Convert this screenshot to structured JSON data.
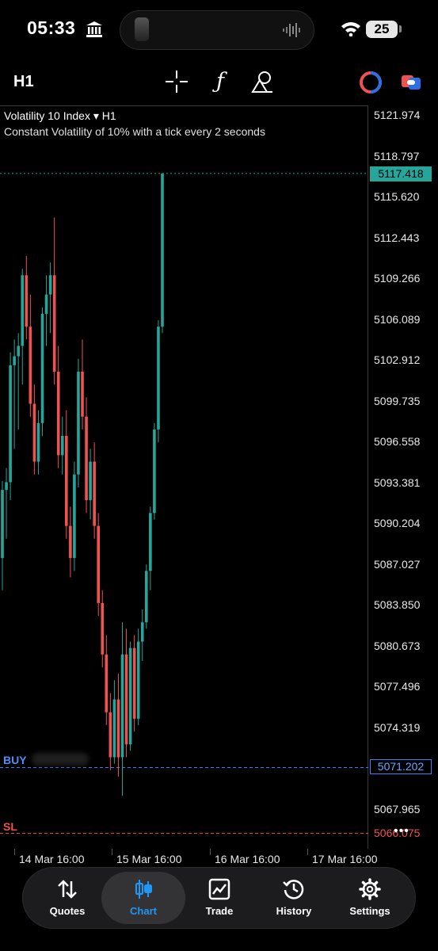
{
  "status_bar": {
    "time": "05:33",
    "battery": "25"
  },
  "toolbar": {
    "timeframe": "H1"
  },
  "chart": {
    "symbol": "Volatility 10 Index",
    "symbol_suffix": "▾ H1",
    "description": "Constant Volatility of 10% with a tick every 2 seconds",
    "current_price": "5117.418",
    "buy_price": "5071.202",
    "sl_price": "5066.075",
    "buy_label": "BUY",
    "sl_label": "SL",
    "colors": {
      "up": "#26a69a",
      "down": "#ef5350",
      "buy": "#3b82f6",
      "sl": "#ef5350"
    }
  },
  "chart_data": {
    "type": "candlestick",
    "ylim": [
      5064.5,
      5123.5
    ],
    "yticks": [
      "5121.974",
      "5118.797",
      "5115.620",
      "5112.443",
      "5109.266",
      "5106.089",
      "5102.912",
      "5099.735",
      "5096.558",
      "5093.381",
      "5090.204",
      "5087.027",
      "5083.850",
      "5080.673",
      "5077.496",
      "5074.319",
      "5067.965"
    ],
    "xticks": [
      "14 Mar 16:00",
      "15 Mar 16:00",
      "16 Mar 16:00",
      "17 Mar 16:00"
    ],
    "candles": [
      [
        5087.5,
        5093.5,
        5085.0,
        5092.8
      ],
      [
        5092.8,
        5094.5,
        5089.0,
        5093.4
      ],
      [
        5093.4,
        5103.5,
        5092.0,
        5102.5
      ],
      [
        5102.5,
        5104.5,
        5096.0,
        5103.2
      ],
      [
        5103.2,
        5105.0,
        5097.5,
        5104.0
      ],
      [
        5104.0,
        5110.0,
        5101.0,
        5109.5
      ],
      [
        5109.5,
        5111.0,
        5104.5,
        5105.5
      ],
      [
        5105.5,
        5108.0,
        5098.5,
        5099.5
      ],
      [
        5099.5,
        5101.0,
        5094.0,
        5095.0
      ],
      [
        5095.0,
        5099.0,
        5094.0,
        5098.0
      ],
      [
        5098.0,
        5107.0,
        5097.0,
        5106.5
      ],
      [
        5106.5,
        5109.5,
        5104.0,
        5108.0
      ],
      [
        5108.0,
        5110.5,
        5105.0,
        5109.5
      ],
      [
        5109.5,
        5114.0,
        5101.0,
        5102.0
      ],
      [
        5102.0,
        5104.0,
        5094.5,
        5095.5
      ],
      [
        5095.5,
        5098.5,
        5094.0,
        5097.0
      ],
      [
        5097.0,
        5099.0,
        5089.0,
        5090.0
      ],
      [
        5090.0,
        5091.5,
        5086.0,
        5087.5
      ],
      [
        5087.5,
        5095.0,
        5086.5,
        5094.0
      ],
      [
        5094.0,
        5103.0,
        5093.0,
        5102.0
      ],
      [
        5102.0,
        5104.5,
        5097.5,
        5098.5
      ],
      [
        5098.5,
        5100.0,
        5091.0,
        5092.0
      ],
      [
        5092.0,
        5096.0,
        5090.5,
        5095.0
      ],
      [
        5095.0,
        5096.5,
        5089.0,
        5090.0
      ],
      [
        5090.0,
        5091.0,
        5083.0,
        5084.0
      ],
      [
        5084.0,
        5085.0,
        5079.0,
        5080.0
      ],
      [
        5080.0,
        5081.5,
        5074.5,
        5075.5
      ],
      [
        5075.5,
        5077.0,
        5071.0,
        5072.0
      ],
      [
        5072.0,
        5078.0,
        5071.5,
        5076.5
      ],
      [
        5076.5,
        5078.5,
        5070.5,
        5072.0
      ],
      [
        5072.0,
        5082.5,
        5069.0,
        5080.0
      ],
      [
        5080.0,
        5082.0,
        5072.0,
        5073.0
      ],
      [
        5073.0,
        5081.0,
        5072.5,
        5080.5
      ],
      [
        5080.5,
        5081.5,
        5074.0,
        5075.0
      ],
      [
        5075.0,
        5082.0,
        5074.5,
        5081.0
      ],
      [
        5081.0,
        5083.5,
        5079.5,
        5082.5
      ],
      [
        5082.5,
        5087.0,
        5082.0,
        5086.5
      ],
      [
        5086.5,
        5091.5,
        5085.0,
        5091.0
      ],
      [
        5091.0,
        5098.0,
        5090.5,
        5097.5
      ],
      [
        5097.5,
        5106.0,
        5096.5,
        5105.5
      ],
      [
        5105.5,
        5117.418,
        5105.0,
        5117.418
      ]
    ]
  },
  "nav": {
    "items": [
      {
        "label": "Quotes"
      },
      {
        "label": "Chart"
      },
      {
        "label": "Trade"
      },
      {
        "label": "History"
      },
      {
        "label": "Settings"
      }
    ]
  }
}
